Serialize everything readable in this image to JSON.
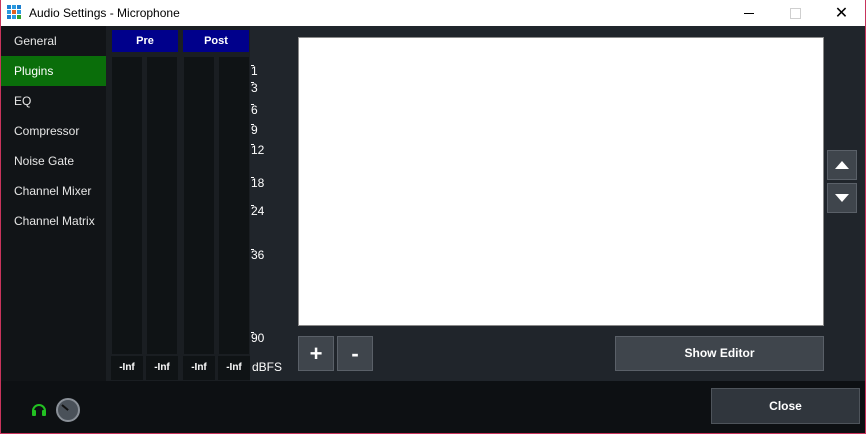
{
  "window": {
    "title": "Audio Settings - Microphone",
    "close_glyph": "✕"
  },
  "sidebar": {
    "items": [
      {
        "label": "General",
        "active": false
      },
      {
        "label": "Plugins",
        "active": true
      },
      {
        "label": "EQ",
        "active": false
      },
      {
        "label": "Compressor",
        "active": false
      },
      {
        "label": "Noise Gate",
        "active": false
      },
      {
        "label": "Channel Mixer",
        "active": false
      },
      {
        "label": "Channel Matrix",
        "active": false
      }
    ]
  },
  "meters": {
    "pre_label": "Pre",
    "post_label": "Post",
    "values": [
      "-Inf",
      "-Inf",
      "-Inf",
      "-Inf"
    ],
    "scale": [
      "1",
      "3",
      "6",
      "9",
      "12",
      "18",
      "24",
      "36",
      "90"
    ],
    "unit": "dBFS"
  },
  "plugins": {
    "add_label": "+",
    "remove_label": "-",
    "show_editor_label": "Show Editor"
  },
  "footer": {
    "close_label": "Close"
  },
  "colors": {
    "active_item": "#0a6e0a",
    "meter_header": "#00008b",
    "headphone": "#22c022"
  }
}
